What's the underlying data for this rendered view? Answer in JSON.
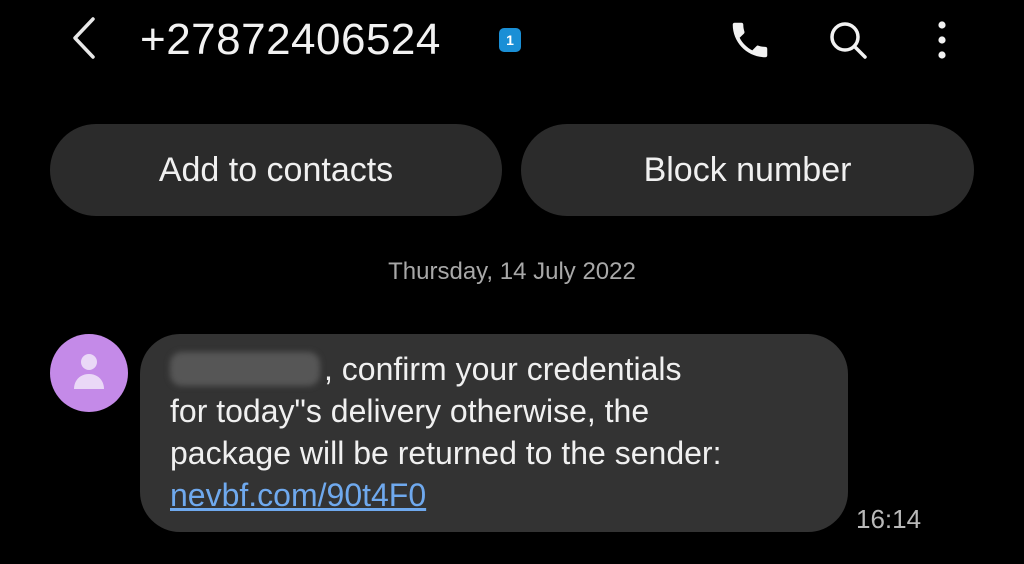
{
  "header": {
    "back_icon": "chevron-left-icon",
    "contact_number": "+27872406524",
    "sim_badge": "1",
    "call_icon": "phone-icon",
    "search_icon": "search-icon",
    "more_icon": "more-vertical-icon"
  },
  "actions": {
    "add_label": "Add to contacts",
    "block_label": "Block number"
  },
  "conversation": {
    "date": "Thursday, 14 July 2022",
    "avatar_icon": "person-icon",
    "message": {
      "line1": ", confirm your credentials",
      "line2": "for today\"s delivery otherwise, the",
      "line3": "package will be returned to the sender:",
      "link": "nevbf.com/90t4F0",
      "time": "16:14"
    }
  },
  "colors": {
    "background": "#000000",
    "pill": "#2b2b2b",
    "bubble": "#333333",
    "link": "#6fa9ee",
    "avatar": "#c48ae8",
    "sim_badge": "#1a8fd6"
  }
}
